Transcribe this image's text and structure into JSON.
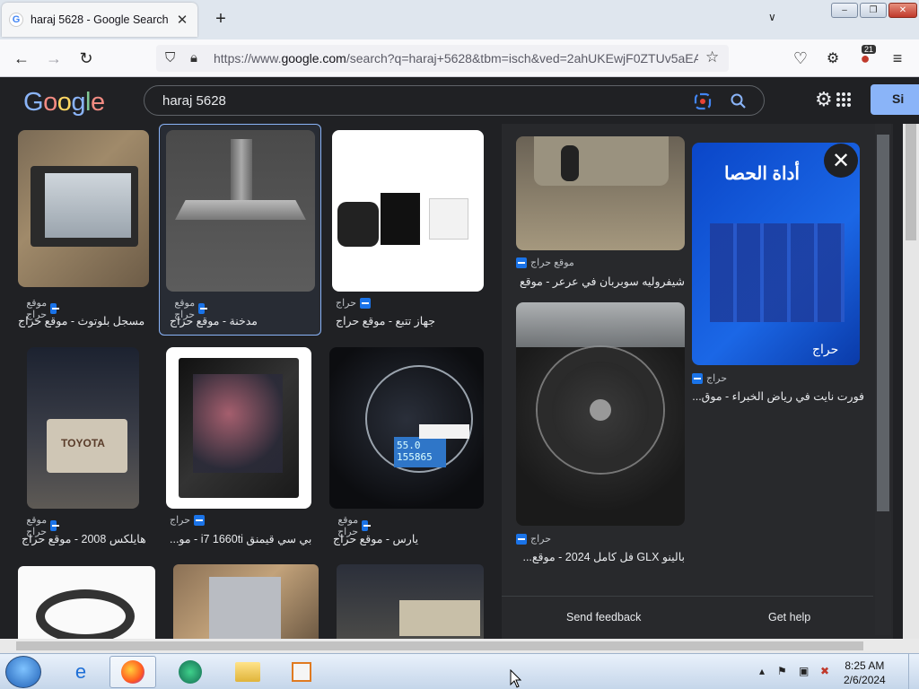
{
  "browser": {
    "tab_title": "haraj 5628 - Google Search",
    "url_prefix": "https://www.",
    "url_domain": "google.com",
    "url_rest": "/search?q=haraj+5628&tbm=isch&ved=2ahUKEwjF0ZTUv5aEA",
    "extension_badge": "21"
  },
  "google": {
    "logo": "Google",
    "query": "haraj 5628",
    "signin_label": "Si"
  },
  "results": [
    {
      "source": "موقع حراج",
      "caption": "مسجل بلوتوث - موقع حراج"
    },
    {
      "source": "موقع حراج",
      "caption": "مدخنة - موقع حراج"
    },
    {
      "source": "حراج",
      "caption": "جهاز تتبع - موقع حراج"
    },
    {
      "source": "موقع حراج",
      "caption": "هايلكس 2008 - موقع حراج"
    },
    {
      "source": "حراج",
      "caption": "بي سي قيمنق i7 1660ti - مو..."
    },
    {
      "source": "موقع حراج",
      "caption": "يارس - موقع حراج"
    }
  ],
  "side_results": [
    {
      "source": "موقع حراج",
      "caption": "شيفروليه سوبربان في عرعر - موقع ..."
    },
    {
      "source": "حراج",
      "caption": "بالينو GLX فل كامل 2024 - موقع..."
    },
    {
      "source": "حراج",
      "caption": "فورت نايت في رياض الخبراء - موق..."
    }
  ],
  "image_text": {
    "fortnite_title": "أداة الحصا",
    "toyota": "TOYOTA",
    "speed_reading": "55.0",
    "odometer": "155865",
    "haraj_watermark": "حراج"
  },
  "side_footer": {
    "feedback": "Send feedback",
    "help": "Get help"
  },
  "taskbar": {
    "time": "8:25 AM",
    "date": "2/6/2024"
  }
}
